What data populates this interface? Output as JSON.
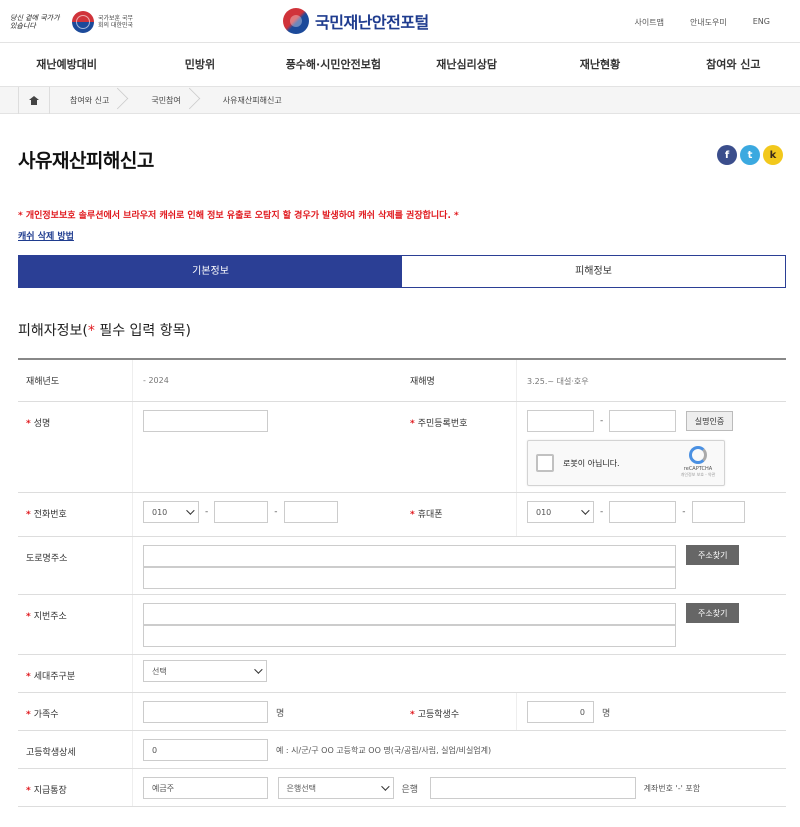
{
  "header": {
    "slogan": "당신 곁에 국가가 있습니다",
    "gov_text": "국가보훈 국무회의 대한민국",
    "site_title": "국민재난안전포털",
    "util_links": [
      "사이트맵",
      "안내도우미",
      "ENG"
    ]
  },
  "nav": [
    "재난예방대비",
    "민방위",
    "풍수해·시민안전보험",
    "재난심리상담",
    "재난현황",
    "참여와 신고"
  ],
  "breadcrumb": [
    "참여와 신고",
    "국민참여",
    "사유재산피해신고"
  ],
  "page_title": "사유재산피해신고",
  "sns": [
    "f",
    "t",
    "k"
  ],
  "notice": "* 개인정보보호 솔루션에서 브라우저 캐쉬로 인해 정보 유출로 오탐지 할 경우가 발생하여 캐쉬 삭제를 권장합니다. *",
  "cache_link": "캐쉬 삭제 방법",
  "tabs": [
    "기본정보",
    "피해정보"
  ],
  "section": {
    "title_a": "피해자정보(",
    "star": "*",
    "title_b": " 필수 입력 항목)"
  },
  "form": {
    "year_label": "재해년도",
    "year_value": "2024",
    "disaster_label": "재해명",
    "disaster_value": "3.25.~ 대설·호우",
    "name_label": "성명",
    "rrn_label": "주민등록번호",
    "verify_btn": "실명인증",
    "captcha_label": "로봇이 아닙니다.",
    "captcha_brand": "reCAPTCHA",
    "captcha_terms": "개인정보 보호 - 약관",
    "phone_label": "전화번호",
    "phone_prefix": "010",
    "mobile_label": "휴대폰",
    "mobile_prefix": "010",
    "road_label": "도로명주소",
    "addr_btn": "주소찾기",
    "lot_label": "지번주소",
    "household_label": "세대주구분",
    "household_value": "선택",
    "family_label": "가족수",
    "family_unit": "명",
    "hs_label": "고등학생수",
    "hs_value": "0",
    "hs_unit": "명",
    "hs_detail_label": "고등학생상세",
    "hs_detail_value": "0",
    "hs_detail_hint": "예 : 시/군/구 OO 고등학교 OO 명(국/공립/사립, 실업/비실업계)",
    "bank_label": "지급통장",
    "bank_holder_placeholder": "예금주",
    "bank_select": "은행선택",
    "bank_unit": "은행",
    "account_hint": "계좌번호 '-' 포함"
  }
}
